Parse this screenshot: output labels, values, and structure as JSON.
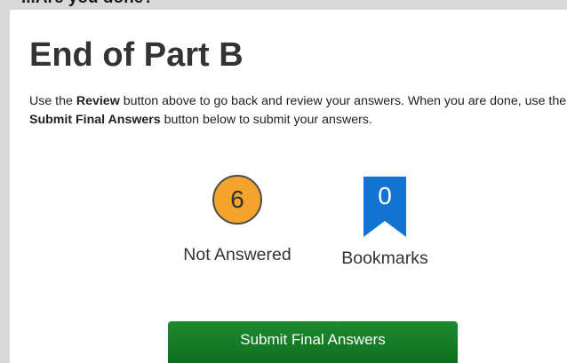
{
  "page": {
    "top_heading_fragment": "...Are you done?",
    "title": "End of Part B",
    "instructions": {
      "part1": "Use the ",
      "bold1": "Review",
      "part2": " button above to go back and review your answers. When you are done, use the ",
      "bold2": "Submit Final Answers",
      "part3": " button below to submit your answers."
    }
  },
  "stats": {
    "not_answered": {
      "count": "6",
      "label": "Not Answered",
      "icon": "circle-badge"
    },
    "bookmarks": {
      "count": "0",
      "label": "Bookmarks",
      "icon": "bookmark-ribbon-icon"
    }
  },
  "actions": {
    "submit_label": "Submit Final Answers"
  },
  "colors": {
    "not_answered_badge": "#f4a32b",
    "bookmark_ribbon": "#1273d2",
    "submit_button": "#137a25",
    "background": "#d9d9d9"
  }
}
